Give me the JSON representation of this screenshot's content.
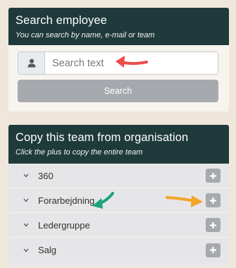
{
  "search_panel": {
    "title": "Search employee",
    "subtitle": "You can search by name, e-mail or team",
    "input_placeholder": "Search text",
    "input_value": "",
    "button_label": "Search",
    "addon_icon": "user-icon"
  },
  "team_panel": {
    "title": "Copy this team from organisation",
    "subtitle": "Click the plus to copy the entire team",
    "items": [
      {
        "label": "360",
        "expand_icon": "chevron-down-icon",
        "action_icon": "plus-icon"
      },
      {
        "label": "Forarbejdning",
        "expand_icon": "chevron-down-icon",
        "action_icon": "plus-icon"
      },
      {
        "label": "Ledergruppe",
        "expand_icon": "chevron-down-icon",
        "action_icon": "plus-icon"
      },
      {
        "label": "Salg",
        "expand_icon": "chevron-down-icon",
        "action_icon": "plus-icon"
      }
    ]
  },
  "colors": {
    "header_bg": "#1f3a3a",
    "button_gray": "#a6a9ae",
    "annotation_red": "#ee4b4b",
    "annotation_green": "#1fa37a",
    "annotation_orange": "#f2a52a"
  }
}
